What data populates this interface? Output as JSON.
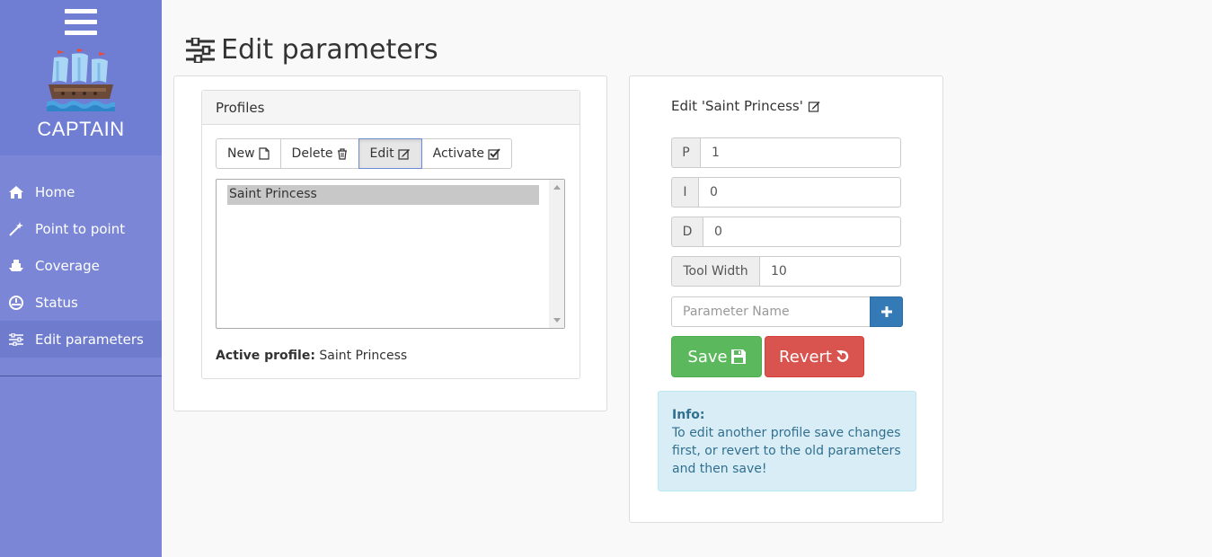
{
  "sidebar": {
    "brand": "CAPTAIN",
    "items": [
      {
        "label": "Home",
        "icon": "home-icon"
      },
      {
        "label": "Point to point",
        "icon": "wand-icon"
      },
      {
        "label": "Coverage",
        "icon": "ship-icon"
      },
      {
        "label": "Status",
        "icon": "dashboard-icon"
      },
      {
        "label": "Edit parameters",
        "icon": "sliders-icon",
        "active": true
      }
    ]
  },
  "page": {
    "title": "Edit parameters"
  },
  "profiles": {
    "heading": "Profiles",
    "buttons": {
      "new": "New",
      "delete": "Delete",
      "edit": "Edit",
      "activate": "Activate"
    },
    "list": [
      "Saint Princess"
    ],
    "active_label": "Active profile:",
    "active_value": "Saint Princess"
  },
  "editor": {
    "title": "Edit 'Saint Princess'",
    "params": [
      {
        "name": "P",
        "value": "1"
      },
      {
        "name": "I",
        "value": "0"
      },
      {
        "name": "D",
        "value": "0"
      },
      {
        "name": "Tool Width",
        "value": "10"
      }
    ],
    "param_name_placeholder": "Parameter Name",
    "save_label": "Save",
    "revert_label": "Revert",
    "info_title": "Info:",
    "info_text": "To edit another profile save changes first, or revert to the old parameters and then save!"
  },
  "colors": {
    "sidebar": "#7b87d6",
    "sidebar_top": "#6f7dd3",
    "save": "#5cb85c",
    "revert": "#d9534f",
    "add": "#337ab7",
    "info_bg": "#d9edf7"
  }
}
